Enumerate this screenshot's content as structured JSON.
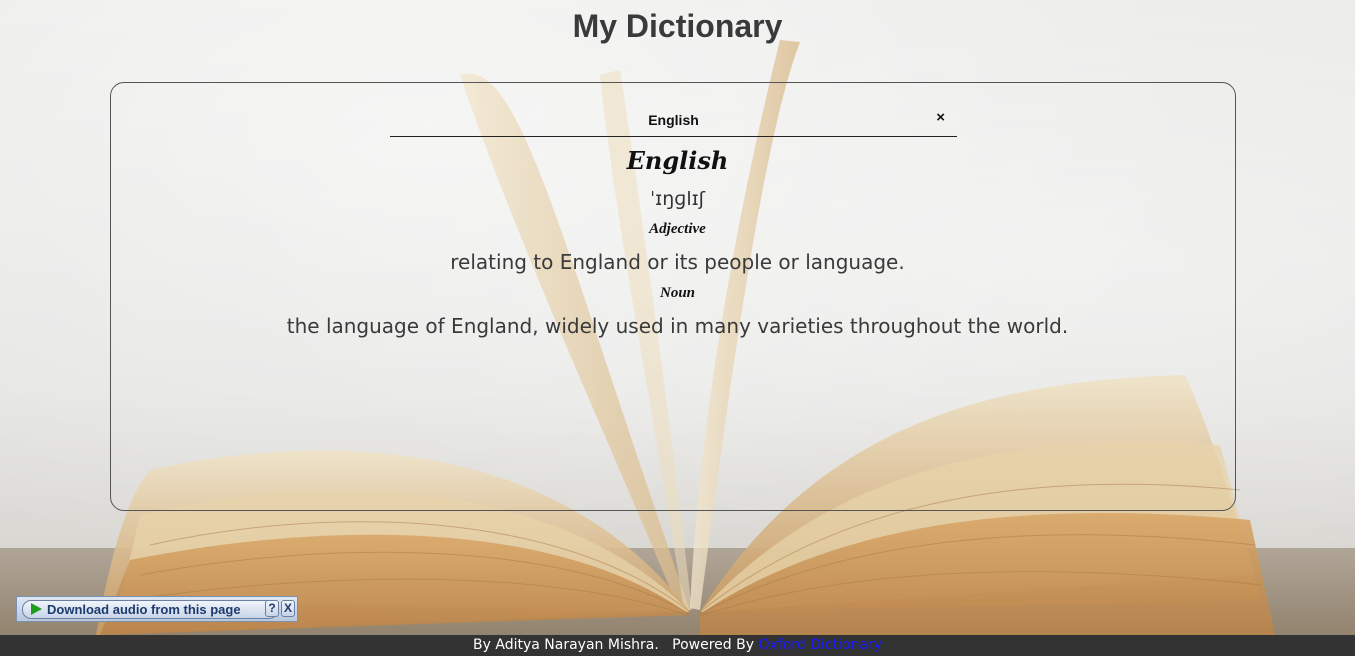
{
  "header": {
    "title": "My Dictionary"
  },
  "search": {
    "value": "English",
    "clear_icon": "×"
  },
  "entry": {
    "word": "English",
    "phonetic": "ˈɪŋɡlɪʃ",
    "meanings": [
      {
        "part_of_speech": "Adjective",
        "definition": "relating to England or its people or language."
      },
      {
        "part_of_speech": "Noun",
        "definition": "the language of England, widely used in many varieties throughout the world."
      }
    ]
  },
  "audio_toolbar": {
    "button_label": "Download audio from this page",
    "help_label": "?",
    "close_label": "X"
  },
  "footer": {
    "author_text": "By Aditya Narayan Mishra.",
    "powered_text": "Powered By",
    "link_text": "Oxford Dictionary"
  },
  "colors": {
    "footer_bg": "#333333",
    "link": "#1a1aff"
  }
}
